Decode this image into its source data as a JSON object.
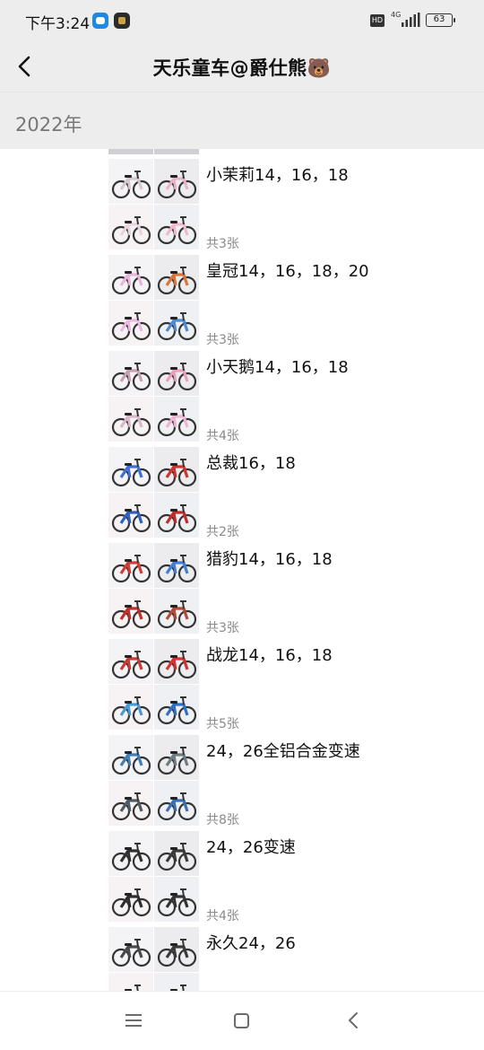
{
  "status_bar": {
    "time": "下午3:24",
    "hd_badge": "HD",
    "network": "4G",
    "battery": "63"
  },
  "header": {
    "title": "天乐童车@爵仕熊🐻"
  },
  "section": {
    "year": "2022年"
  },
  "colors": {
    "bar_background": "#ededed",
    "year_text": "#777777",
    "count_text": "#8a8a8a"
  },
  "entries": [
    {
      "title": "小茉莉14，16，18",
      "count": "共3张",
      "tones": [
        "#d9c7cf",
        "#e9b4c7",
        "#e7d6df",
        "#f2b8cc"
      ]
    },
    {
      "title": "皇冠14，16，18，20",
      "count": "共3张",
      "tones": [
        "#e8b6dc",
        "#d9753b",
        "#e9b9e0",
        "#4f8ad0"
      ]
    },
    {
      "title": "小天鹅14，16，18",
      "count": "共4张",
      "tones": [
        "#c9a1b4",
        "#ea9fbb",
        "#d9b8c8",
        "#f0b3d1"
      ]
    },
    {
      "title": "总裁16，18",
      "count": "共2张",
      "tones": [
        "#3f6fd8",
        "#d2312f",
        "#2d5fc4",
        "#c42a2a"
      ]
    },
    {
      "title": "猎豹14，16，18",
      "count": "共3张",
      "tones": [
        "#d33b33",
        "#3f7fd6",
        "#c22f2b",
        "#b34a35"
      ]
    },
    {
      "title": "战龙14，16，18",
      "count": "共5张",
      "tones": [
        "#c83a33",
        "#d63131",
        "#4a9ad6",
        "#2e6fc6"
      ]
    },
    {
      "title": "24，26全铝合金变速",
      "count": "共8张",
      "tones": [
        "#3e7fb8",
        "#6e7b82",
        "#4e5b62",
        "#3b6fb5"
      ]
    },
    {
      "title": "24，26变速",
      "count": "共4张",
      "tones": [
        "#303030",
        "#3a3a3a",
        "#2e2e2e",
        "#333333"
      ]
    },
    {
      "title": "永久24，26",
      "count": "",
      "tones": [
        "#4a4a4a",
        "#3a3a3a",
        "#555555",
        "#444444"
      ]
    }
  ],
  "nav": {
    "menu_icon": "menu-icon",
    "home_icon": "home-square-icon",
    "back_icon": "back-triangle-icon"
  }
}
